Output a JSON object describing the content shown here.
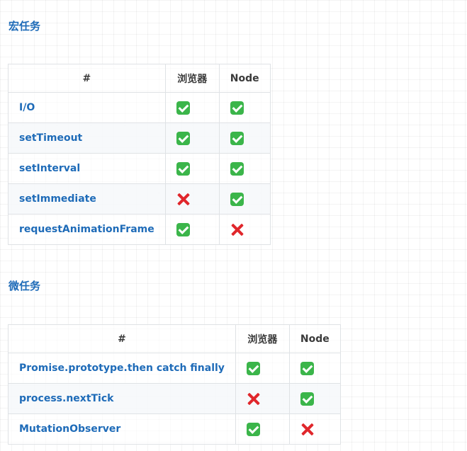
{
  "macro": {
    "title": "宏任务",
    "headers": [
      "#",
      "浏览器",
      "Node"
    ],
    "rows": [
      {
        "name": "I/O",
        "browser": "check-icon",
        "node": "check-icon"
      },
      {
        "name": "setTimeout",
        "browser": "check-icon",
        "node": "check-icon"
      },
      {
        "name": "setInterval",
        "browser": "check-icon",
        "node": "check-icon"
      },
      {
        "name": "setImmediate",
        "browser": "cross-icon",
        "node": "check-icon"
      },
      {
        "name": "requestAnimationFrame",
        "browser": "check-icon",
        "node": "cross-icon"
      }
    ]
  },
  "micro": {
    "title": "微任务",
    "headers": [
      "#",
      "浏览器",
      "Node"
    ],
    "rows": [
      {
        "name": "Promise.prototype.then catch finally",
        "browser": "check-icon",
        "node": "check-icon"
      },
      {
        "name": "process.nextTick",
        "browser": "cross-icon",
        "node": "check-icon"
      },
      {
        "name": "MutationObserver",
        "browser": "check-icon",
        "node": "cross-icon"
      }
    ]
  },
  "colors": {
    "link": "#1e6bb8",
    "check": "#3bb54a",
    "cross": "#e0262b",
    "border": "#dfe2e5"
  }
}
